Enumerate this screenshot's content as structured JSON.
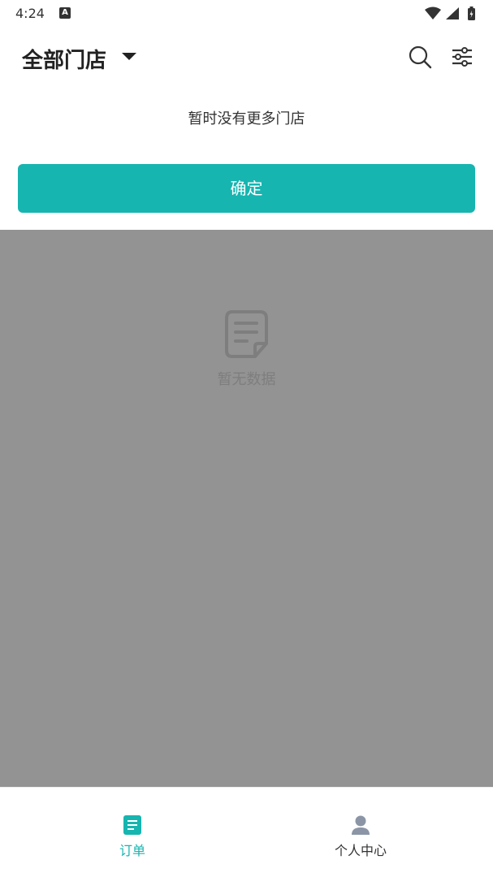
{
  "status_bar": {
    "time": "4:24",
    "notification_icon": "a-icon",
    "icons": [
      "wifi-icon",
      "signal-icon",
      "battery-icon"
    ]
  },
  "header": {
    "store_selector_label": "全部门店",
    "icons": [
      "search-icon",
      "filter-sliders-icon"
    ]
  },
  "store_dropdown": {
    "message": "暂时没有更多门店",
    "confirm_label": "确定"
  },
  "content": {
    "empty_icon": "document-icon",
    "empty_text": "暂无数据"
  },
  "bottom_nav": {
    "items": [
      {
        "label": "订单",
        "icon": "orders-icon",
        "active": true
      },
      {
        "label": "个人中心",
        "icon": "user-icon",
        "active": false
      }
    ]
  },
  "colors": {
    "accent": "#16b5b0",
    "overlay": "#939393",
    "text_primary": "#222222"
  }
}
